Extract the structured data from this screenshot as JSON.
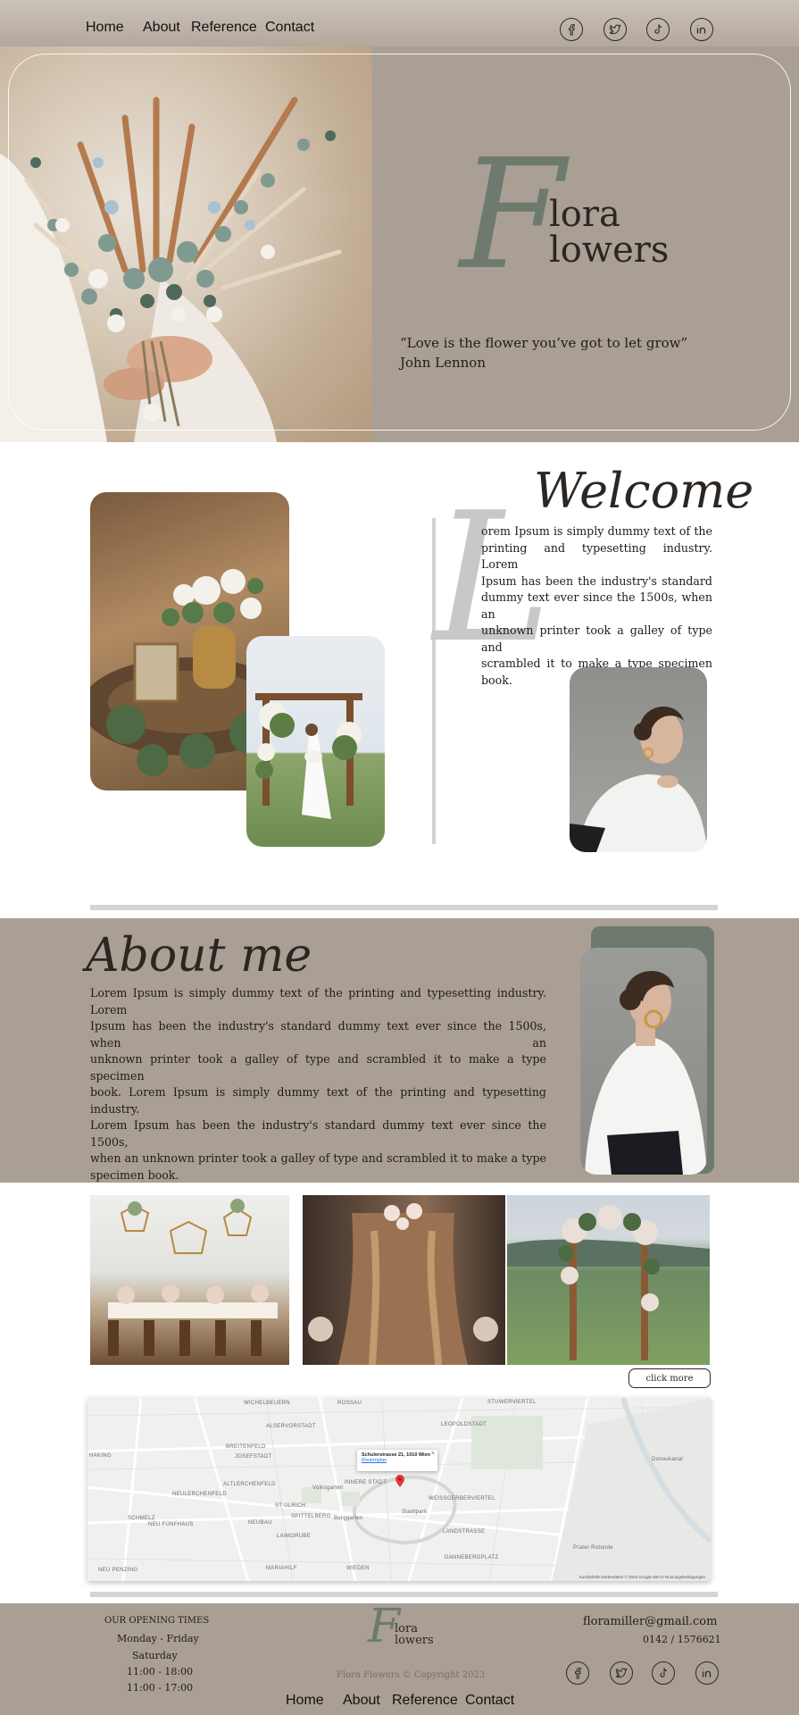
{
  "nav": {
    "home": "Home",
    "about": "About",
    "reference": "Reference",
    "contact": "Contact"
  },
  "social_icons": [
    "facebook-icon",
    "twitter-icon",
    "tiktok-icon",
    "linkedin-icon"
  ],
  "hero": {
    "logo_initial": "F",
    "logo_line1": "lora",
    "logo_line2": "lowers",
    "quote": "“Love is the flower you’ve got to let grow”",
    "author": "John Lennon"
  },
  "welcome": {
    "title": "Welcome",
    "drop_cap": "L",
    "lines": [
      "orem Ipsum is simply dummy text of the",
      "printing and typesetting industry. Lorem",
      "Ipsum has been the industry's standard",
      "dummy text ever since the 1500s, when an",
      "unknown printer took a galley of type and",
      "scrambled it to make a type specimen",
      "book."
    ]
  },
  "about": {
    "title": "About me",
    "lines": [
      "Lorem Ipsum is simply dummy text of the printing and typesetting industry. Lorem",
      "Ipsum has been the industry's standard dummy text ever since the 1500s, when an",
      "unknown printer took a galley of type and scrambled it to make a type specimen",
      "book. Lorem Ipsum is simply dummy text of the printing and typesetting industry.",
      "Lorem Ipsum has been the industry's standard dummy text ever since the 1500s,",
      "when an unknown printer took a galley of type and scrambled it to make a type",
      "specimen book."
    ]
  },
  "gallery": {
    "button": "click more"
  },
  "map": {
    "popup_address": "Schulerstrasse 21, 1010 Wien",
    "popup_link": "Routenplan",
    "labels": [
      "WICHELBEUERN",
      "ROSSAU",
      "STUWERVIERTEL",
      "ALSERVORSTADT",
      "LEOPOLDSTADT",
      "BREITENFELD",
      "JOSEFSTADT",
      "INNERE STADT",
      "ALTLERCHENFELD",
      "NEULERCHENFELD",
      "ST ULRICH",
      "WEISSGERBERVIERTEL",
      "SCHMELZ",
      "SPITTELBERG",
      "NEUBAU",
      "LAIMGRUBE",
      "LANDSTRASSE",
      "DANNEBERGPLATZ",
      "MARIAHILF",
      "WIEDEN",
      "NEU FÜNFHAUS",
      "HAKING",
      "NEU PENZING",
      "Volksgarten",
      "Burggarten",
      "Stadtpark",
      "Prater Rotunde",
      "Donaukanal"
    ],
    "attribution": "Kurzbefehle   Kartendaten © 2023 Google   500 m   Nutzungsbedingungen"
  },
  "footer": {
    "hours_title": "OUR OPENING TIMES",
    "hours_days1": "Monday - Friday",
    "hours_days2": "Saturday",
    "hours_time1": "11:00 - 18:00",
    "hours_time2": "11:00 - 17:00",
    "logo_initial": "F",
    "logo_line1": "lora",
    "logo_line2": "lowers",
    "copyright": "Flora Flowers © Copyright 2023",
    "email": "floramiller@gmail.com",
    "phone": "0142 / 1576621",
    "nav_home": "Home",
    "nav_about": "About",
    "nav_reference": "Reference",
    "nav_contact": "Contact"
  },
  "colors": {
    "taupe": "#aa9f94",
    "sage": "#6e7a6e",
    "rule": "#d4d4d4"
  }
}
